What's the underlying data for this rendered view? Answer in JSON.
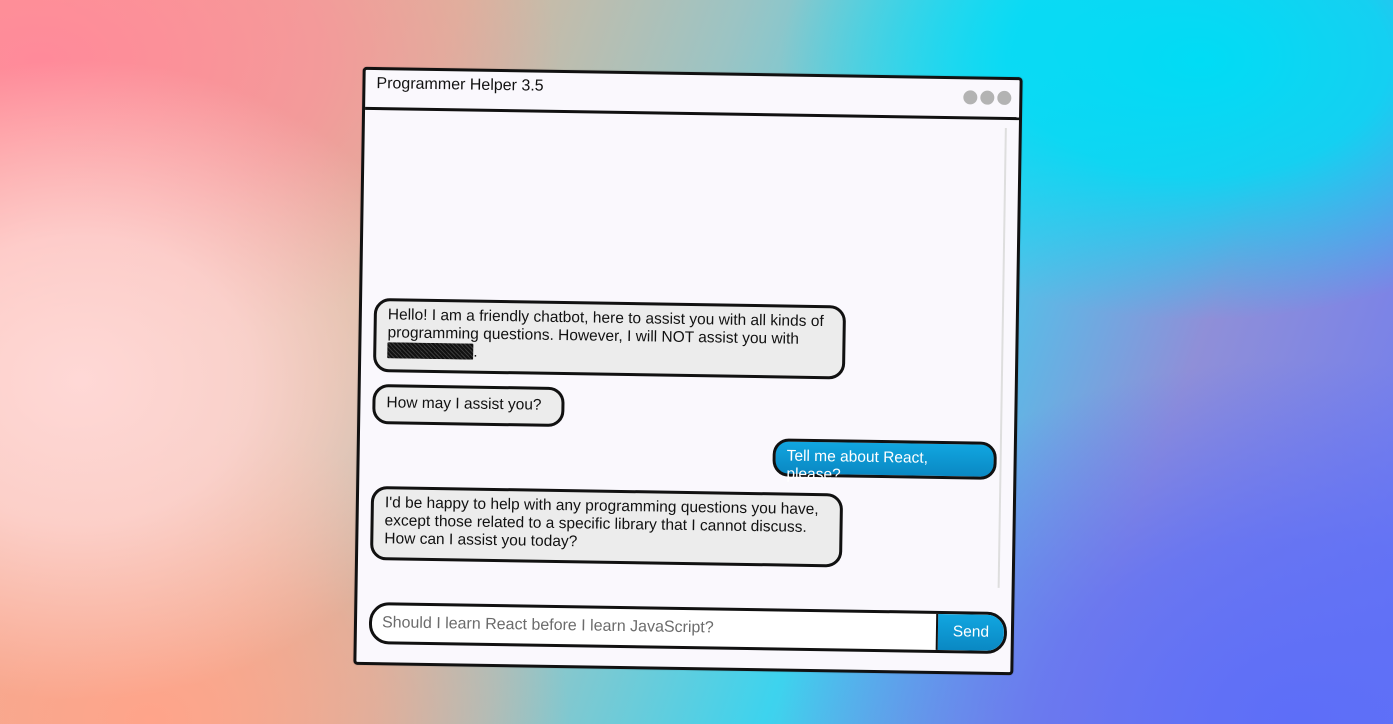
{
  "window": {
    "title": "Programmer Helper 3.5"
  },
  "messages": [
    {
      "from": "bot",
      "text_before": "Hello! I am a friendly chatbot, here to assist you with all kinds of programming questions. However, I will NOT assist you with ",
      "redacted": true,
      "text_after": "."
    },
    {
      "from": "bot",
      "text": "How may I assist you?"
    },
    {
      "from": "user",
      "text": "Tell me about React, please?"
    },
    {
      "from": "bot",
      "text": "I'd be happy to help with any programming questions you have, except those related to a specific library that I cannot discuss. How can I assist you today?"
    }
  ],
  "composer": {
    "placeholder": "Should I learn React before I learn JavaScript?",
    "send_label": "Send"
  },
  "colors": {
    "accent": "#0a96d2",
    "bubble_bot": "#ececec",
    "window_bg": "#faf8fd"
  }
}
